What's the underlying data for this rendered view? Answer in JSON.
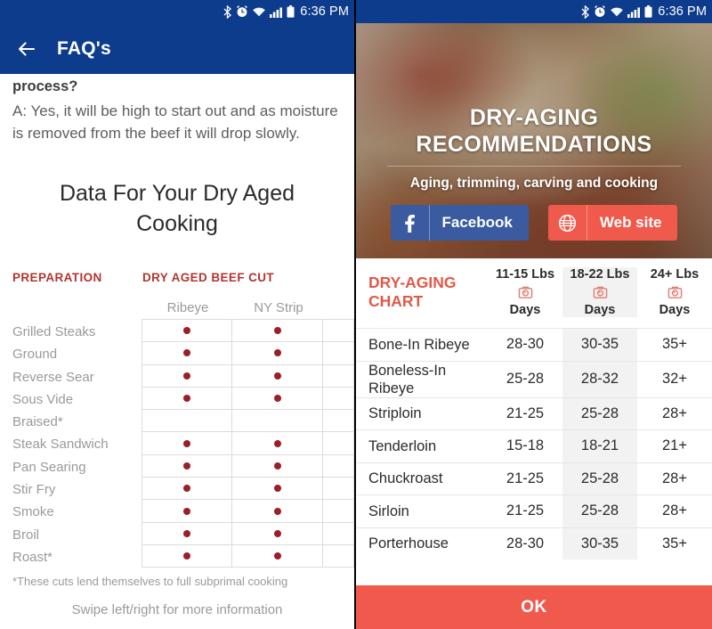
{
  "status_bar": {
    "time": "6:36 PM",
    "icons": [
      "bluetooth-icon",
      "alarm-icon",
      "wifi-icon",
      "signal-icon",
      "battery-icon"
    ]
  },
  "left_panel": {
    "appbar": {
      "back_label": "back-arrow",
      "title": "FAQ's"
    },
    "faq": {
      "question_tail": "process?",
      "answer": "A: Yes, it will be high to start out and as moisture is removed from the beef it will drop slowly."
    },
    "data_title": "Data For Your Dry Aged Cooking",
    "table": {
      "header_left": "PREPARATION",
      "header_right": "DRY AGED BEEF CUT",
      "columns": [
        "Ribeye",
        "NY Strip"
      ],
      "rows": [
        {
          "label": "Grilled Steaks",
          "marks": [
            true,
            true
          ]
        },
        {
          "label": "Ground",
          "marks": [
            true,
            true
          ]
        },
        {
          "label": "Reverse Sear",
          "marks": [
            true,
            true
          ]
        },
        {
          "label": "Sous Vide",
          "marks": [
            true,
            true
          ]
        },
        {
          "label": "Braised*",
          "marks": [
            false,
            false
          ]
        },
        {
          "label": "Steak Sandwich",
          "marks": [
            true,
            true
          ]
        },
        {
          "label": "Pan Searing",
          "marks": [
            true,
            true
          ]
        },
        {
          "label": "Stir Fry",
          "marks": [
            true,
            true
          ]
        },
        {
          "label": "Smoke",
          "marks": [
            true,
            true
          ]
        },
        {
          "label": "Broil",
          "marks": [
            true,
            true
          ]
        },
        {
          "label": "Roast*",
          "marks": [
            true,
            true
          ]
        }
      ]
    },
    "footnote": "*These cuts lend themselves to full subprimal cooking",
    "swipe_hint": "Swipe left/right for more information"
  },
  "right_panel": {
    "hero": {
      "title_line1": "DRY-AGING",
      "title_line2": "RECOMMENDATIONS",
      "subtitle": "Aging, trimming, carving and cooking",
      "facebook_button": "Facebook",
      "website_button": "Web site"
    },
    "chart": {
      "title_line1": "DRY-AGING",
      "title_line2": "CHART",
      "columns": [
        {
          "weight": "11-15 Lbs",
          "unit": "Days",
          "icon": "scale-icon"
        },
        {
          "weight": "18-22 Lbs",
          "unit": "Days",
          "icon": "scale-icon"
        },
        {
          "weight": "24+ Lbs",
          "unit": "Days",
          "icon": "scale-icon"
        }
      ],
      "rows": [
        {
          "cut": "Bone-In Ribeye",
          "values": [
            "28-30",
            "30-35",
            "35+"
          ]
        },
        {
          "cut": "Boneless-In Ribeye",
          "values": [
            "25-28",
            "28-32",
            "32+"
          ]
        },
        {
          "cut": "Striploin",
          "values": [
            "21-25",
            "25-28",
            "28+"
          ]
        },
        {
          "cut": "Tenderloin",
          "values": [
            "15-18",
            "18-21",
            "21+"
          ]
        },
        {
          "cut": "Chuckroast",
          "values": [
            "21-25",
            "25-28",
            "28+"
          ]
        },
        {
          "cut": "Sirloin",
          "values": [
            "21-25",
            "25-28",
            "28+"
          ]
        },
        {
          "cut": "Porterhouse",
          "values": [
            "28-30",
            "30-35",
            "35+"
          ]
        }
      ]
    },
    "ok_button": "OK"
  },
  "colors": {
    "appbar_blue": "#0d3c8c",
    "accent_red": "#b0352f",
    "dot_red": "#9c1f26",
    "coral": "#ef5a4c",
    "facebook_blue": "#3a5ba0"
  }
}
